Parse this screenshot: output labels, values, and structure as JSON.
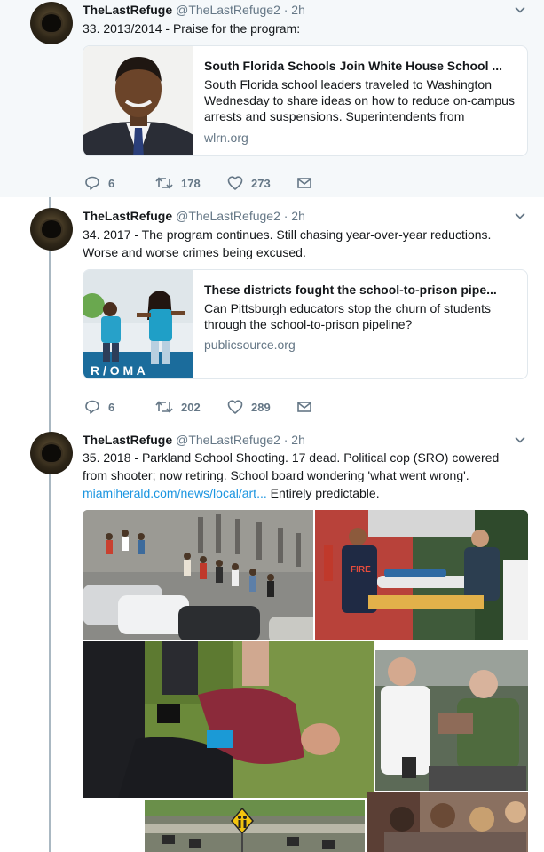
{
  "tweets": [
    {
      "name": "TheLastRefuge",
      "handle": "@TheLastRefuge2 · 2h",
      "text": "33.  2013/2014 - Praise for the program:",
      "card": {
        "title": "South Florida Schools Join White House School ...",
        "description": "South Florida school leaders traveled to Washington Wednesday to share ideas on how to reduce on-campus arrests and suspensions. Superintendents from",
        "domain": "wlrn.org"
      },
      "replies": "6",
      "retweets": "178",
      "likes": "273"
    },
    {
      "name": "TheLastRefuge",
      "handle": "@TheLastRefuge2 · 2h",
      "text": "34.  2017 - The program continues.  Still chasing year-over-year reductions.  Worse and worse crimes being excused.",
      "card": {
        "title": "These districts fought the school-to-prison pipe...",
        "description": "Can Pittsburgh educators stop the churn of students through the school-to-prison pipeline?",
        "domain": "publicsource.org"
      },
      "replies": "6",
      "retweets": "202",
      "likes": "289"
    },
    {
      "name": "TheLastRefuge",
      "handle": "@TheLastRefuge2 · 2h",
      "text_before_link": "35.  2018 -  Parkland School Shooting.  17 dead.  Political cop (SRO) cowered from shooter; now retiring.  School board wondering 'what went wrong'.",
      "link": "miamiherald.com/news/local/art...",
      "text_after_link": "  Entirely predictable.",
      "media_sign_icon": "school-crossing-sign-icon"
    }
  ],
  "icons": {
    "reply": "reply-icon",
    "retweet": "retweet-icon",
    "like": "heart-icon",
    "message": "envelope-icon",
    "more": "chevron-down-icon"
  },
  "colors": {
    "thread_line": "#aab8c2",
    "muted": "#657786",
    "link": "#1b95e0",
    "tint": "#f5f8fa"
  }
}
